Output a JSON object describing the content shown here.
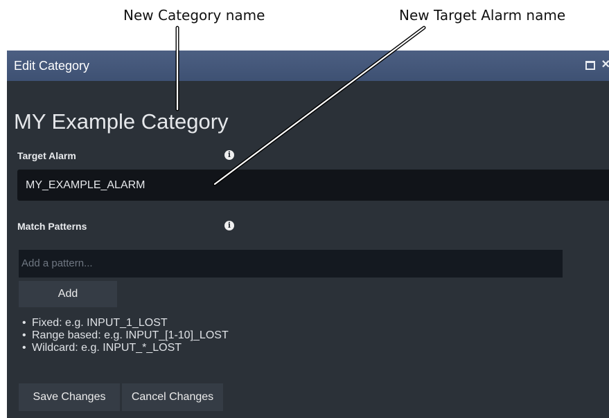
{
  "callouts": {
    "category_name": "New Category name",
    "target_alarm_name": "New Target Alarm name"
  },
  "dialog": {
    "title": "Edit Category",
    "title_buttons": [
      "maximize-icon",
      "close-icon"
    ],
    "close_glyph": "✕",
    "category_name": "MY Example Category",
    "target_alarm": {
      "label": "Target Alarm",
      "info_glyph": "i",
      "value": "MY_EXAMPLE_ALARM"
    },
    "match_patterns": {
      "label": "Match Patterns",
      "info_glyph": "i",
      "placeholder": "Add a pattern...",
      "add_label": "Add",
      "hints": [
        "Fixed: e.g. INPUT_1_LOST",
        "Range based: e.g. INPUT_[1-10]_LOST",
        "Wildcard: e.g. INPUT_*_LOST"
      ]
    },
    "save_label": "Save Changes",
    "cancel_label": "Cancel Changes"
  },
  "colors": {
    "titlebar": "#4c5f82",
    "dialog_bg": "#2b3138",
    "field_bg": "#111419",
    "button_bg": "#353c45"
  }
}
